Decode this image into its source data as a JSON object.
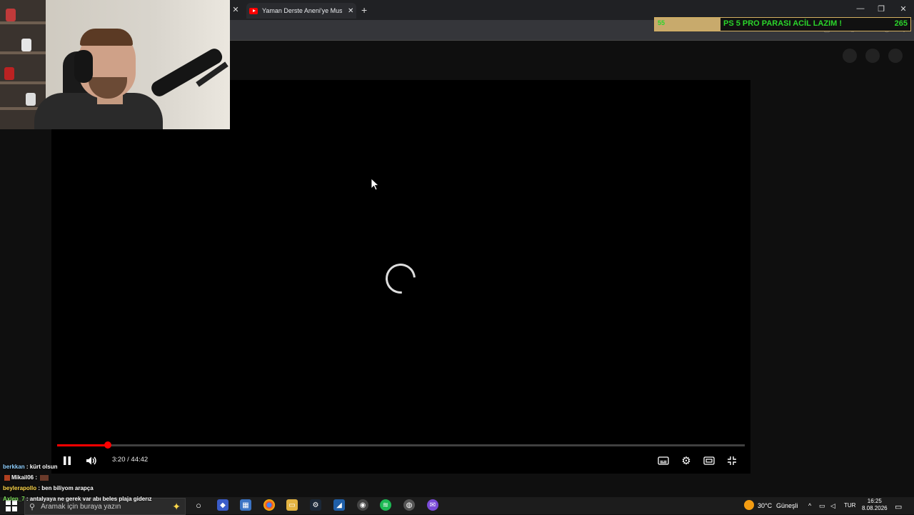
{
  "browser": {
    "active_tab_title": "Yaman Derste Aneni'ye Musallat",
    "close_glyph": "✕",
    "new_tab_glyph": "+"
  },
  "donation": {
    "left_value": "55",
    "title": "PS 5 PRO PARASI ACİL LAZIM !",
    "count": "265",
    "accent_color": "#2bd52b",
    "bar_color": "#c8aa6c"
  },
  "player": {
    "time": "3:20 / 44:42",
    "progress_fraction": 0.074,
    "state": "buffering"
  },
  "chat": [
    {
      "user": "berkkan",
      "message": "kürt olsun",
      "color": "#8fd0ff"
    },
    {
      "user": "Mikail06",
      "message": "",
      "color": "#ffffff",
      "badge": true
    },
    {
      "user": "beylerapollo",
      "message": "ben biliyom arapça",
      "color": "#ffd84a"
    },
    {
      "user": "Axlen_7",
      "message": "antalyaya ne gerek var abı beles plaja giderız",
      "color": "#7cdc5a"
    }
  ],
  "taskbar": {
    "search_placeholder": "Aramak için buraya yazın",
    "weather_temp": "30°C",
    "weather_desc": "Güneşli",
    "language": "TUR",
    "time": "16:25",
    "date": "8.08.2026"
  }
}
